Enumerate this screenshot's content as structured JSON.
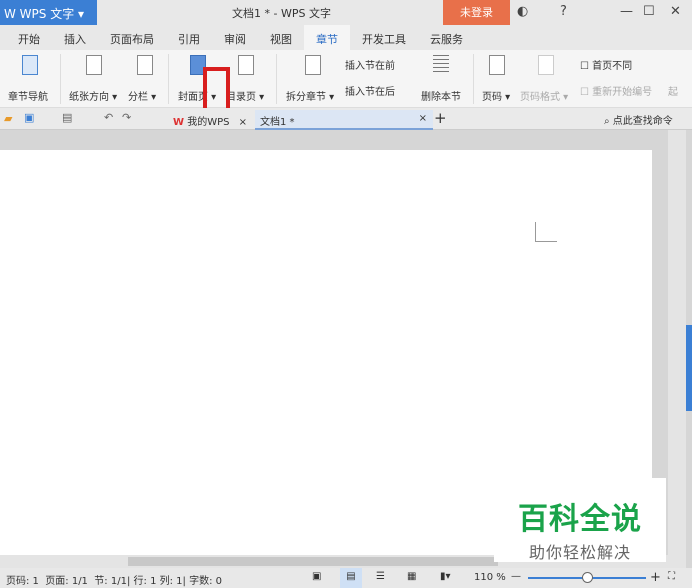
{
  "titlebar": {
    "app": "W WPS 文字",
    "app_menu": "▾",
    "title": "文档1 * - WPS 文字",
    "login": "未登录",
    "skin": "◐",
    "help": "?",
    "minimize": "—",
    "maximize": "☐",
    "close": "✕"
  },
  "tabs": [
    "开始",
    "插入",
    "页面布局",
    "引用",
    "审阅",
    "视图",
    "章节",
    "开发工具",
    "云服务"
  ],
  "active_tab": "章节",
  "ribbon": {
    "nav": "章节导航",
    "orientation": "纸张方向 ▾",
    "columns": "分栏 ▾",
    "cover": "封面页 ▾",
    "toc": "目录页 ▾",
    "split": "拆分章节 ▾",
    "insert_before": "插入节在前",
    "insert_after": "插入节在后",
    "delete_section": "删除本节",
    "page_num": "页码 ▾",
    "page_num_format": "页码格式 ▾",
    "first_diff": "首页不同",
    "restart_num": "重新开始编号",
    "more": "起"
  },
  "doctabs": {
    "mywps": "我的WPS",
    "doc": "文档1 *",
    "close": "×",
    "add": "+",
    "search": "点此查找命令"
  },
  "status": {
    "page": "页码: 1",
    "pages": "页面: 1/1",
    "section": "节: 1/1",
    "row": "行: 1",
    "col": "列: 1",
    "words": "字数: 0",
    "zoom": "110 %",
    "zoom_minus": "—",
    "zoom_plus": "+"
  },
  "zoom_percent": 110,
  "watermark": {
    "title": "百科全说",
    "subtitle": "助你轻松解决"
  }
}
